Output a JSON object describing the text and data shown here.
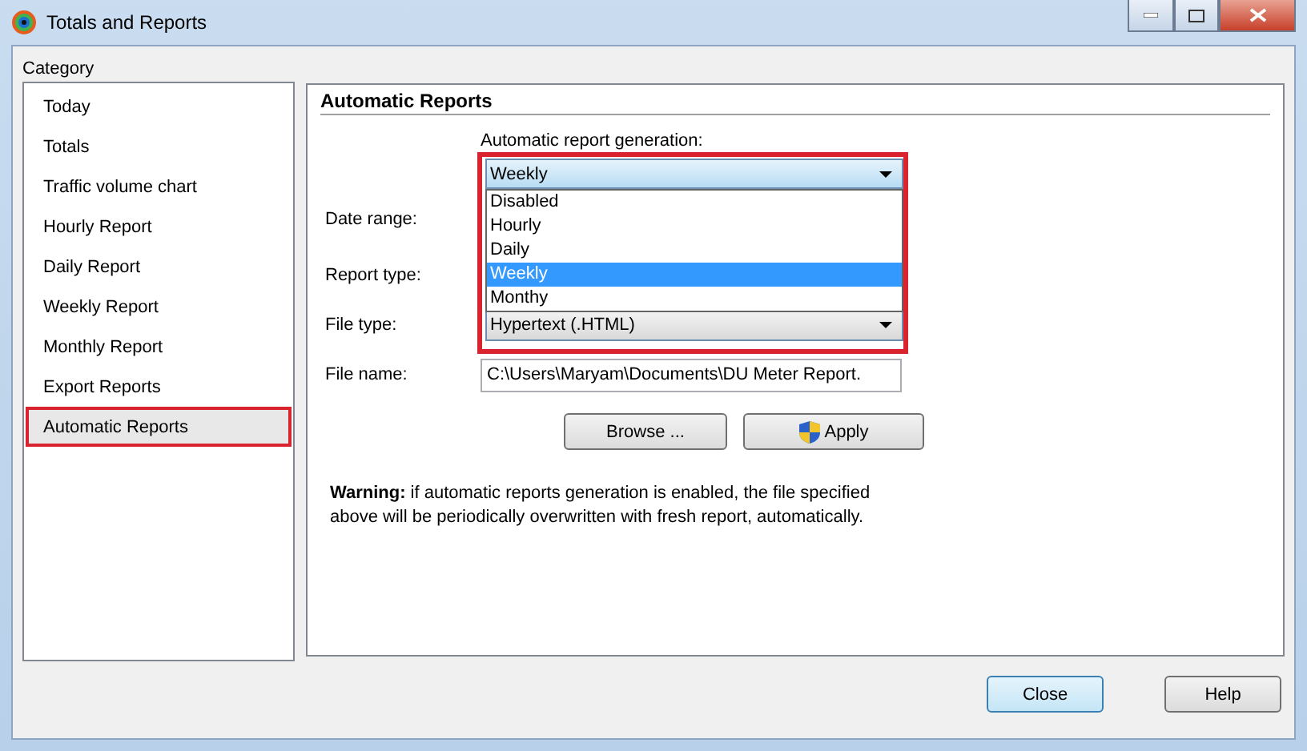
{
  "window": {
    "title": "Totals and Reports"
  },
  "category": {
    "label": "Category",
    "items": [
      {
        "label": "Today",
        "selected": false,
        "highlighted": false
      },
      {
        "label": "Totals",
        "selected": false,
        "highlighted": false
      },
      {
        "label": "Traffic volume chart",
        "selected": false,
        "highlighted": false
      },
      {
        "label": "Hourly Report",
        "selected": false,
        "highlighted": false
      },
      {
        "label": "Daily Report",
        "selected": false,
        "highlighted": false
      },
      {
        "label": "Weekly Report",
        "selected": false,
        "highlighted": false
      },
      {
        "label": "Monthly Report",
        "selected": false,
        "highlighted": false
      },
      {
        "label": "Export Reports",
        "selected": false,
        "highlighted": false
      },
      {
        "label": "Automatic Reports",
        "selected": true,
        "highlighted": true
      }
    ]
  },
  "panel": {
    "title": "Automatic Reports",
    "generation": {
      "label": "Automatic report generation:",
      "value": "Weekly",
      "expanded": true,
      "highlighted": true,
      "options": [
        {
          "label": "Disabled",
          "selected": false
        },
        {
          "label": "Hourly",
          "selected": false
        },
        {
          "label": "Daily",
          "selected": false
        },
        {
          "label": "Weekly",
          "selected": true
        },
        {
          "label": "Monthy",
          "selected": false
        }
      ]
    },
    "fields": [
      {
        "kind": "covered",
        "label": "Date range:"
      },
      {
        "kind": "covered",
        "label": "Report type:"
      },
      {
        "kind": "select",
        "label": "File type:",
        "value": "Hypertext (.HTML)"
      },
      {
        "kind": "text",
        "label": "File name:",
        "value": "C:\\Users\\Maryam\\Documents\\DU Meter Report."
      }
    ],
    "buttons": [
      {
        "label": "Browse ...",
        "shield": false
      },
      {
        "label": "Apply",
        "shield": true
      }
    ],
    "warning": "**Warning:** if automatic reports generation is enabled, the file specified above will be periodically overwritten with fresh report, automatically."
  },
  "footer_buttons": [
    {
      "label": "Close",
      "default": true
    },
    {
      "label": "Help",
      "default": false
    }
  ]
}
